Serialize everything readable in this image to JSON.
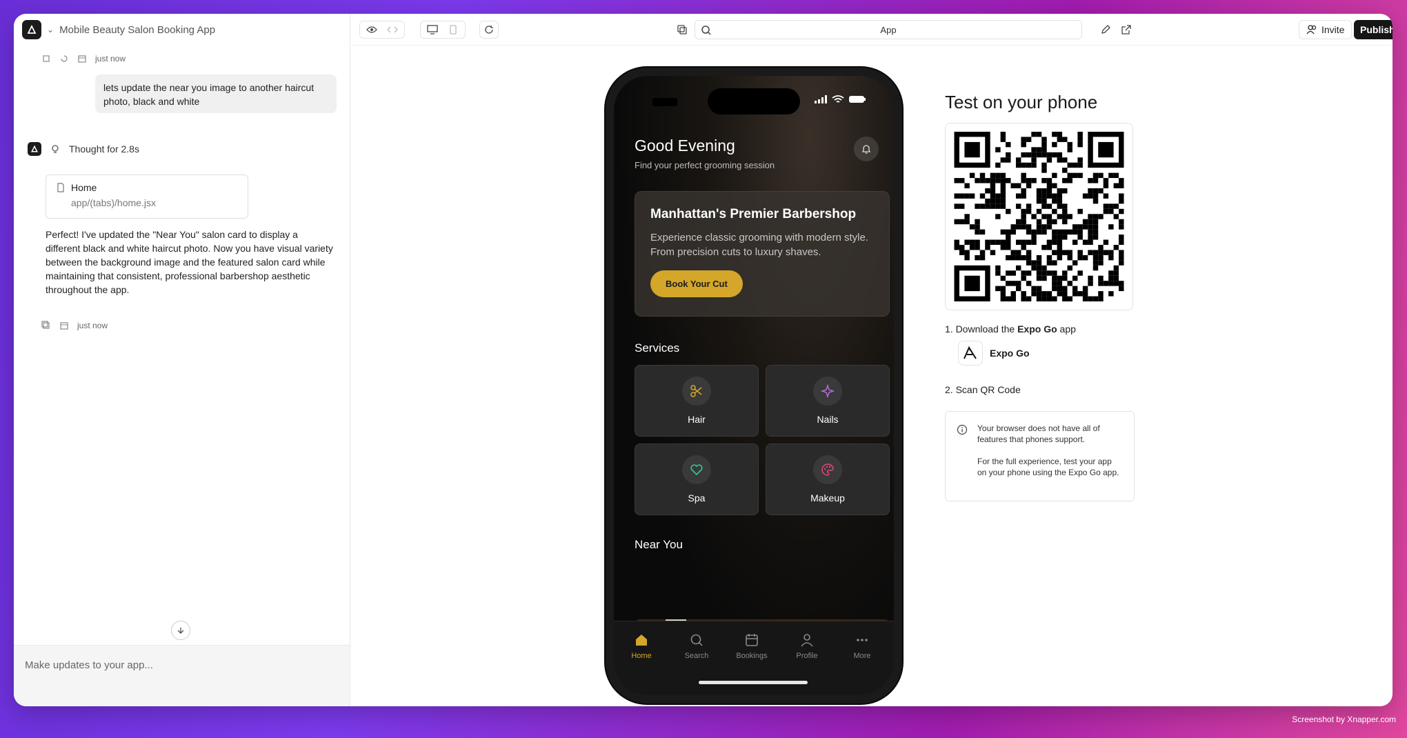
{
  "app": {
    "title": "Mobile Beauty Salon Booking App"
  },
  "chat": {
    "top_meta_time": "just now",
    "user_message": "lets update the near you image to another haircut photo, black and white",
    "thought_label": "Thought for 2.8s",
    "file_card": {
      "name": "Home",
      "path": "app/(tabs)/home.jsx"
    },
    "assistant_message": "Perfect! I've updated the \"Near You\" salon card to display a different black and white haircut photo. Now you have visual variety between the background image and the featured salon card while maintaining that consistent, professional barbershop aesthetic throughout the app.",
    "assistant_meta_time": "just now",
    "composer_placeholder": "Make updates to your app..."
  },
  "toolbar": {
    "url_text": "App",
    "invite_label": "Invite",
    "publish_label": "Publish"
  },
  "phone": {
    "greeting": "Good Evening",
    "greeting_sub": "Find your perfect grooming session",
    "hero": {
      "title": "Manhattan's Premier Barbershop",
      "description": "Experience classic grooming with modern style. From precision cuts to luxury shaves.",
      "button": "Book Your Cut"
    },
    "services_title": "Services",
    "services": [
      {
        "label": "Hair",
        "icon": "scissors-icon",
        "color": "#d4a62a"
      },
      {
        "label": "Nails",
        "icon": "sparkles-icon",
        "color": "#b46ad8"
      },
      {
        "label": "Spa",
        "icon": "heart-icon",
        "color": "#34c79a"
      },
      {
        "label": "Makeup",
        "icon": "palette-icon",
        "color": "#e0477a"
      }
    ],
    "near_you_title": "Near You",
    "tabs": [
      {
        "label": "Home",
        "icon": "home-icon",
        "active": true
      },
      {
        "label": "Search",
        "icon": "search-icon",
        "active": false
      },
      {
        "label": "Bookings",
        "icon": "calendar-icon",
        "active": false
      },
      {
        "label": "Profile",
        "icon": "user-icon",
        "active": false
      },
      {
        "label": "More",
        "icon": "more-icon",
        "active": false
      }
    ],
    "accent": "#d4a62a"
  },
  "qr_panel": {
    "title": "Test on your phone",
    "step1_prefix": "1. Download the ",
    "step1_bold": "Expo Go",
    "step1_suffix": " app",
    "expo_label": "Expo Go",
    "step2": "2. Scan QR Code",
    "notice_line1": "Your browser does not have all of features that phones support.",
    "notice_line2": "For the full experience, test your app on your phone using the Expo Go app."
  },
  "watermark": "Screenshot by Xnapper.com"
}
